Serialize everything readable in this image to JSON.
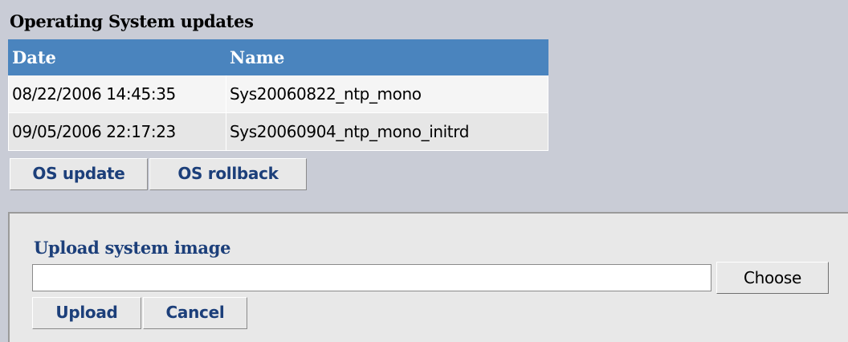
{
  "section": {
    "title": "Operating System updates"
  },
  "updates_table": {
    "columns": [
      "Date",
      "Name"
    ],
    "rows": [
      {
        "date": "08/22/2006 14:45:35",
        "name": "Sys20060822_ntp_mono"
      },
      {
        "date": "09/05/2006 22:17:23",
        "name": "Sys20060904_ntp_mono_initrd"
      }
    ]
  },
  "actions": {
    "os_update_label": "OS update",
    "os_rollback_label": "OS rollback"
  },
  "upload": {
    "title": "Upload system image",
    "file_value": "",
    "choose_label": "Choose",
    "upload_label": "Upload",
    "cancel_label": "Cancel"
  },
  "colors": {
    "header_bg": "#4a84be",
    "page_bg": "#c9ccd6",
    "button_text": "#1c3f7a"
  }
}
